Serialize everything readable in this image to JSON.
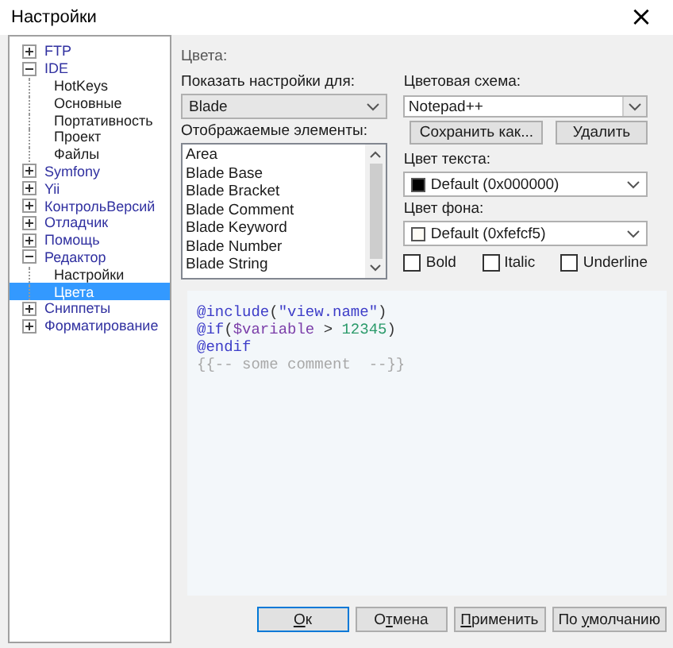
{
  "window": {
    "title": "Настройки",
    "close": "×"
  },
  "tree": [
    {
      "label": "FTP",
      "expanded": false,
      "selected": false
    },
    {
      "label": "IDE",
      "expanded": true,
      "selected": false,
      "children": [
        {
          "label": "HotKeys",
          "selected": false
        },
        {
          "label": "Основные",
          "selected": false
        },
        {
          "label": "Портативность",
          "selected": false
        },
        {
          "label": "Проект",
          "selected": false
        },
        {
          "label": "Файлы",
          "selected": false
        }
      ]
    },
    {
      "label": "Symfony",
      "expanded": false,
      "selected": false
    },
    {
      "label": "Yii",
      "expanded": false,
      "selected": false
    },
    {
      "label": "КонтрольВерсий",
      "expanded": false,
      "selected": false
    },
    {
      "label": "Отладчик",
      "expanded": false,
      "selected": false
    },
    {
      "label": "Помощь",
      "expanded": false,
      "selected": false
    },
    {
      "label": "Редактор",
      "expanded": true,
      "selected": false,
      "children": [
        {
          "label": "Настройки",
          "selected": false
        },
        {
          "label": "Цвета",
          "selected": true
        }
      ]
    },
    {
      "label": "Сниппеты",
      "expanded": false,
      "selected": false
    },
    {
      "label": "Форматирование",
      "expanded": false,
      "selected": false
    }
  ],
  "colors": {
    "group_label": "Цвета:",
    "show_for_label": "Показать настройки для:",
    "show_for_value": "Blade",
    "elements_label": "Отображаемые элементы:",
    "elements": [
      {
        "label": "Area",
        "selected": false
      },
      {
        "label": "Blade Base",
        "selected": false
      },
      {
        "label": "Blade Bracket",
        "selected": false
      },
      {
        "label": "Blade Comment",
        "selected": false
      },
      {
        "label": "Blade Keyword",
        "selected": false
      },
      {
        "label": "Blade Number",
        "selected": false
      },
      {
        "label": "Blade String",
        "selected": false
      }
    ],
    "scheme_label": "Цветовая схема:",
    "scheme_value": "Notepad++",
    "save_as": "Сохранить как...",
    "delete": "Удалить",
    "text_color_label": "Цвет текста:",
    "text_color_value": "Default (0x000000)",
    "bg_color_label": "Цвет фона:",
    "bg_color_value": "Default (0xfefcf5)",
    "checkboxes": [
      {
        "label": "Bold",
        "checked": false
      },
      {
        "label": "Italic",
        "checked": false
      },
      {
        "label": "Underline",
        "checked": false
      }
    ]
  },
  "preview": [
    [
      {
        "text": "@include",
        "color": "#3c3cc8"
      },
      {
        "text": "(",
        "color": "#333333"
      },
      {
        "text": "\"view.name\"",
        "color": "#3c3cc8"
      },
      {
        "text": ")",
        "color": "#333333"
      }
    ],
    [
      {
        "text": "@if",
        "color": "#3c3cc8"
      },
      {
        "text": "(",
        "color": "#333333"
      },
      {
        "text": "$variable",
        "color": "#7a3ca8"
      },
      {
        "text": " > ",
        "color": "#333333"
      },
      {
        "text": "12345",
        "color": "#2a9a6a"
      },
      {
        "text": ")",
        "color": "#333333"
      }
    ],
    [
      {
        "text": "@endif",
        "color": "#3c3cc8"
      }
    ],
    [
      {
        "text": "{{-- some comment  --}}",
        "color": "#a8a8a8"
      }
    ]
  ],
  "buttons": [
    {
      "label": [
        {
          "text": "О",
          "underline": true
        },
        {
          "text": "к",
          "underline": false
        }
      ],
      "default": true
    },
    {
      "label": [
        {
          "text": "О",
          "underline": false
        },
        {
          "text": "т",
          "underline": true
        },
        {
          "text": "мена",
          "underline": false
        }
      ],
      "default": false
    },
    {
      "label": [
        {
          "text": "П",
          "underline": true
        },
        {
          "text": "рименить",
          "underline": false
        }
      ],
      "default": false
    },
    {
      "label": [
        {
          "text": "По ",
          "underline": false
        },
        {
          "text": "у",
          "underline": true
        },
        {
          "text": "молчанию",
          "underline": false
        }
      ],
      "default": false
    }
  ]
}
